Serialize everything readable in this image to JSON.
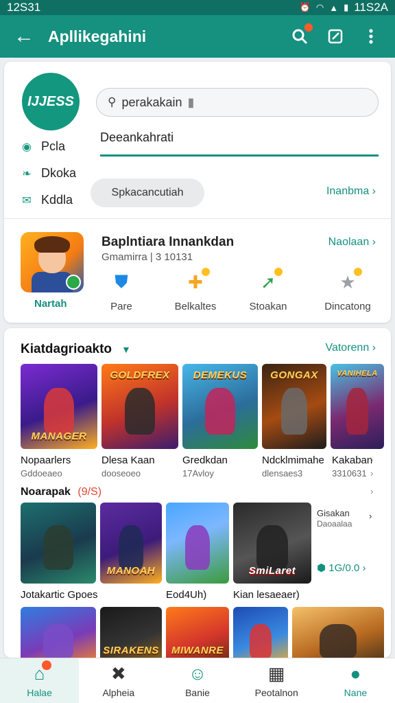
{
  "status_bar": {
    "time": "12S31",
    "right_text": "11S2A"
  },
  "app_bar": {
    "title": "Apllikegahini"
  },
  "profile": {
    "logo_text": "IJJESS",
    "links": [
      {
        "icon": "circle-icon",
        "label": "Pcla"
      },
      {
        "icon": "leaf-icon",
        "label": "Dkoka"
      },
      {
        "icon": "mail-icon",
        "label": "Kddla"
      }
    ]
  },
  "search": {
    "value": "perakakain"
  },
  "description": {
    "value": "Deeankahrati"
  },
  "chip": {
    "label": "Spkacancutiah"
  },
  "link_inanbma": "Inanbma ›",
  "featured": {
    "title": "Baplntiara Innankdan",
    "subtitle": "Gmamirra | 3 10131",
    "label": "Nartah",
    "link": "Naolaan ›",
    "actions": [
      {
        "icon": "shield-icon",
        "label": "Pare"
      },
      {
        "icon": "puzzle-icon",
        "label": "Belkaltes"
      },
      {
        "icon": "arrow-icon",
        "label": "Stoakan"
      },
      {
        "icon": "star-icon",
        "label": "Dincatong"
      }
    ]
  },
  "section1": {
    "title": "Kiatdagrioakto",
    "link": "Vatorenn ›",
    "games": [
      {
        "art": "MANAGER",
        "name": "Nopaarlers",
        "sub": "Gddoeaeo"
      },
      {
        "art": "GOLDFREX",
        "name": "Dlesa Kaan",
        "sub": "dooseoeo"
      },
      {
        "art": "DEMEKUS",
        "name": "Gredkdan",
        "sub": "17Avloy"
      },
      {
        "art": "GONGAX",
        "name": "Ndcklmimahe",
        "sub": "dlensaes3"
      },
      {
        "art": "VANIHELA",
        "name": "Kakaban",
        "sub": "3310631"
      }
    ]
  },
  "section2": {
    "title": "Noarapak",
    "count": "(9/S)",
    "games": [
      {
        "art": "",
        "name": "Jotakartic Gpoes"
      },
      {
        "art": "MANOAH",
        "name": ""
      },
      {
        "art": "",
        "name": "Eod4Uh)"
      },
      {
        "art": "SmiLaret",
        "name": "Kian lesaeaer)"
      }
    ],
    "side_title": "Gisakan",
    "side_sub": "Daoaalaa",
    "side_rating": "1G/0.0 ›"
  },
  "section3": {
    "games": [
      {
        "art": ""
      },
      {
        "art": "SIRAKENS"
      },
      {
        "art": "MIWANRE"
      },
      {
        "art": ""
      },
      {
        "art": ""
      }
    ]
  },
  "bottom_nav": [
    {
      "icon": "home-icon",
      "label": "Halae"
    },
    {
      "icon": "gamepad-icon",
      "label": "Alpheia"
    },
    {
      "icon": "users-icon",
      "label": "Banie"
    },
    {
      "icon": "calendar-icon",
      "label": "Peotalnon"
    },
    {
      "icon": "person-icon",
      "label": "Nane"
    }
  ],
  "colors": {
    "primary": "#16907f",
    "statusbar": "#0f6f63",
    "accent": "#ff5a2c"
  }
}
